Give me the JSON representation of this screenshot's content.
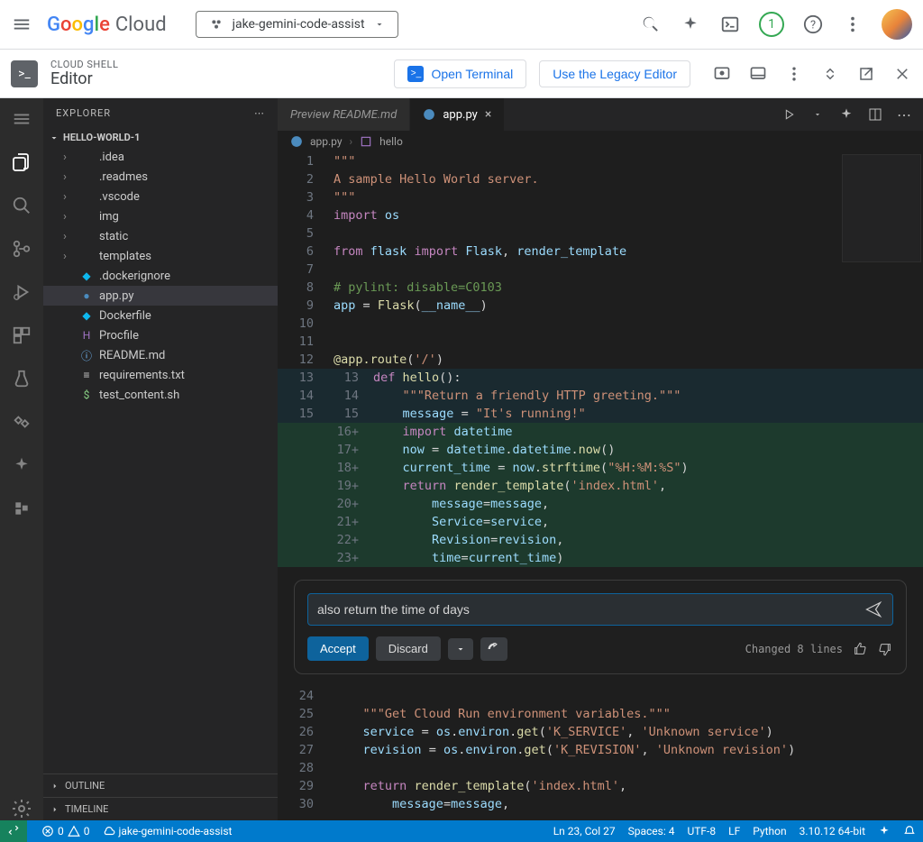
{
  "header": {
    "brand_google": "Google",
    "brand_cloud": "Cloud",
    "project": "jake-gemini-code-assist",
    "badge_count": "1"
  },
  "shell": {
    "subtitle": "CLOUD SHELL",
    "title": "Editor",
    "open_terminal": "Open Terminal",
    "legacy_editor": "Use the Legacy Editor"
  },
  "sidebar": {
    "explorer_label": "EXPLORER",
    "folder_name": "HELLO-WORLD-1",
    "items": [
      {
        "name": ".idea",
        "type": "folder"
      },
      {
        "name": ".readmes",
        "type": "folder"
      },
      {
        "name": ".vscode",
        "type": "folder"
      },
      {
        "name": "img",
        "type": "folder"
      },
      {
        "name": "static",
        "type": "folder"
      },
      {
        "name": "templates",
        "type": "folder"
      },
      {
        "name": ".dockerignore",
        "type": "docker"
      },
      {
        "name": "app.py",
        "type": "py",
        "selected": true
      },
      {
        "name": "Dockerfile",
        "type": "docker"
      },
      {
        "name": "Procfile",
        "type": "h"
      },
      {
        "name": "README.md",
        "type": "info"
      },
      {
        "name": "requirements.txt",
        "type": "txt"
      },
      {
        "name": "test_content.sh",
        "type": "sh"
      }
    ],
    "outline": "OUTLINE",
    "timeline": "TIMELINE"
  },
  "tabs": {
    "inactive": "Preview README.md",
    "active": "app.py"
  },
  "breadcrumbs": {
    "file": "app.py",
    "symbol": "hello"
  },
  "code": {
    "lines": [
      {
        "n": "1",
        "html": "<span class='k-str'>\"\"\"</span>"
      },
      {
        "n": "2",
        "html": "<span class='k-str'>A sample Hello World server.</span>"
      },
      {
        "n": "3",
        "html": "<span class='k-str'>\"\"\"</span>"
      },
      {
        "n": "4",
        "html": "<span class='k-kw'>import</span> <span class='k-var'>os</span>"
      },
      {
        "n": "5",
        "html": ""
      },
      {
        "n": "6",
        "html": "<span class='k-kw'>from</span> <span class='k-var'>flask</span> <span class='k-kw'>import</span> <span class='k-var'>Flask</span><span class='k-op'>, </span><span class='k-var'>render_template</span>"
      },
      {
        "n": "7",
        "html": ""
      },
      {
        "n": "8",
        "html": "<span class='k-com'># pylint: disable=C0103</span>"
      },
      {
        "n": "9",
        "html": "<span class='k-var'>app</span> <span class='k-op'>=</span> <span class='k-fn'>Flask</span><span class='k-op'>(</span><span class='k-var'>__name__</span><span class='k-op'>)</span>"
      },
      {
        "n": "10",
        "html": ""
      },
      {
        "n": "11",
        "html": ""
      },
      {
        "n": "12",
        "html": "<span class='k-fn'>@app.route</span><span class='k-op'>(</span><span class='k-str'>'/'</span><span class='k-op'>)</span>"
      }
    ],
    "diff": [
      {
        "old": "13",
        "new": "13",
        "add": false,
        "html": "<span class='k-kw'>def</span> <span class='k-fn'>hello</span><span class='k-op'>():</span>"
      },
      {
        "old": "14",
        "new": "14",
        "add": false,
        "html": "    <span class='k-str'>\"\"\"Return a friendly HTTP greeting.\"\"\"</span>"
      },
      {
        "old": "15",
        "new": "15",
        "add": false,
        "html": "    <span class='k-var'>message</span> <span class='k-op'>=</span> <span class='k-str'>\"It's running!\"</span>"
      },
      {
        "old": "",
        "new": "16",
        "add": true,
        "html": "    <span class='k-kw'>import</span> <span class='k-var'>datetime</span>"
      },
      {
        "old": "",
        "new": "17",
        "add": true,
        "html": "    <span class='k-var'>now</span> <span class='k-op'>=</span> <span class='k-var'>datetime</span><span class='k-op'>.</span><span class='k-var'>datetime</span><span class='k-op'>.</span><span class='k-fn'>now</span><span class='k-op'>()</span>"
      },
      {
        "old": "",
        "new": "18",
        "add": true,
        "html": "    <span class='k-var'>current_time</span> <span class='k-op'>=</span> <span class='k-var'>now</span><span class='k-op'>.</span><span class='k-fn'>strftime</span><span class='k-op'>(</span><span class='k-str'>\"%H:%M:%S\"</span><span class='k-op'>)</span>"
      },
      {
        "old": "",
        "new": "19",
        "add": true,
        "html": "    <span class='k-kw'>return</span> <span class='k-fn'>render_template</span><span class='k-op'>(</span><span class='k-str'>'index.html'</span><span class='k-op'>,</span>"
      },
      {
        "old": "",
        "new": "20",
        "add": true,
        "html": "        <span class='k-var'>message</span><span class='k-op'>=</span><span class='k-var'>message</span><span class='k-op'>,</span>"
      },
      {
        "old": "",
        "new": "21",
        "add": true,
        "html": "        <span class='k-var'>Service</span><span class='k-op'>=</span><span class='k-var'>service</span><span class='k-op'>,</span>"
      },
      {
        "old": "",
        "new": "22",
        "add": true,
        "html": "        <span class='k-var'>Revision</span><span class='k-op'>=</span><span class='k-var'>revision</span><span class='k-op'>,</span>"
      },
      {
        "old": "",
        "new": "23",
        "add": true,
        "html": "        <span class='k-var'>time</span><span class='k-op'>=</span><span class='k-var'>current_time</span><span class='k-op'>)</span>"
      }
    ],
    "after": [
      {
        "n": "24",
        "html": ""
      },
      {
        "n": "25",
        "html": "    <span class='k-str'>\"\"\"Get Cloud Run environment variables.\"\"\"</span>"
      },
      {
        "n": "26",
        "html": "    <span class='k-var'>service</span> <span class='k-op'>=</span> <span class='k-var'>os</span><span class='k-op'>.</span><span class='k-var'>environ</span><span class='k-op'>.</span><span class='k-fn'>get</span><span class='k-op'>(</span><span class='k-str'>'K_SERVICE'</span><span class='k-op'>, </span><span class='k-str'>'Unknown service'</span><span class='k-op'>)</span>"
      },
      {
        "n": "27",
        "html": "    <span class='k-var'>revision</span> <span class='k-op'>=</span> <span class='k-var'>os</span><span class='k-op'>.</span><span class='k-var'>environ</span><span class='k-op'>.</span><span class='k-fn'>get</span><span class='k-op'>(</span><span class='k-str'>'K_REVISION'</span><span class='k-op'>, </span><span class='k-str'>'Unknown revision'</span><span class='k-op'>)</span>"
      },
      {
        "n": "28",
        "html": ""
      },
      {
        "n": "29",
        "html": "    <span class='k-kw'>return</span> <span class='k-fn'>render_template</span><span class='k-op'>(</span><span class='k-str'>'index.html'</span><span class='k-op'>,</span>"
      },
      {
        "n": "30",
        "html": "        <span class='k-var'>message</span><span class='k-op'>=</span><span class='k-var'>message</span><span class='k-op'>,</span>"
      }
    ]
  },
  "ai": {
    "prompt_value": "also return the time of days",
    "accept": "Accept",
    "discard": "Discard",
    "status": "Changed 8 lines"
  },
  "status": {
    "errors": "0",
    "warnings": "0",
    "remote_project": "jake-gemini-code-assist",
    "position": "Ln 23, Col 27",
    "spaces": "Spaces: 4",
    "encoding": "UTF-8",
    "eol": "LF",
    "lang": "Python",
    "interpreter": "3.10.12 64-bit"
  }
}
